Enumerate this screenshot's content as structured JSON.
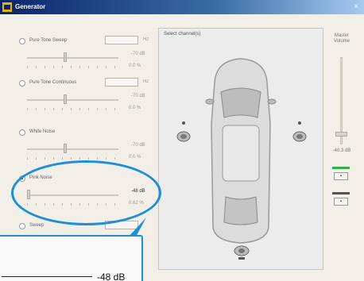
{
  "window": {
    "title": "Generator",
    "close_glyph": "×"
  },
  "modes": [
    {
      "label": "Pure Tone Sweep",
      "selected": false,
      "freq": "440",
      "unit": "Hz",
      "level": "-70 dB",
      "pct": "0.0 %"
    },
    {
      "label": "Pure Tone Continuous",
      "selected": false,
      "freq": "440",
      "unit": "Hz",
      "level": "-70 dB",
      "pct": "0.0 %"
    },
    {
      "label": "White Noise",
      "selected": false,
      "freq": "",
      "unit": "",
      "level": "-70 dB",
      "pct": "0.0 %"
    },
    {
      "label": "Pink Noise",
      "selected": true,
      "freq": "",
      "unit": "",
      "level": "-48 dB",
      "pct": "0.62 %"
    },
    {
      "label": "Sweep",
      "selected": false,
      "freq": "",
      "unit": "",
      "level": "",
      "pct": ""
    }
  ],
  "channel_panel": {
    "label": "Select channel(s)"
  },
  "volume": {
    "label": "Master Volume",
    "value": "-40.3 dB",
    "level_fraction": 0.12
  },
  "mute_buttons": [
    {
      "label": "▪",
      "indicator_color": "#2fb24a"
    },
    {
      "label": "▪",
      "indicator_color": "#555555"
    }
  ],
  "callout": {
    "zoomed_level": "-48 dB",
    "accent_color": "#1e8ed6"
  },
  "icons": {
    "app": "generator-app-icon",
    "car": "car-top-view-icon",
    "speaker": "speaker-icon"
  }
}
